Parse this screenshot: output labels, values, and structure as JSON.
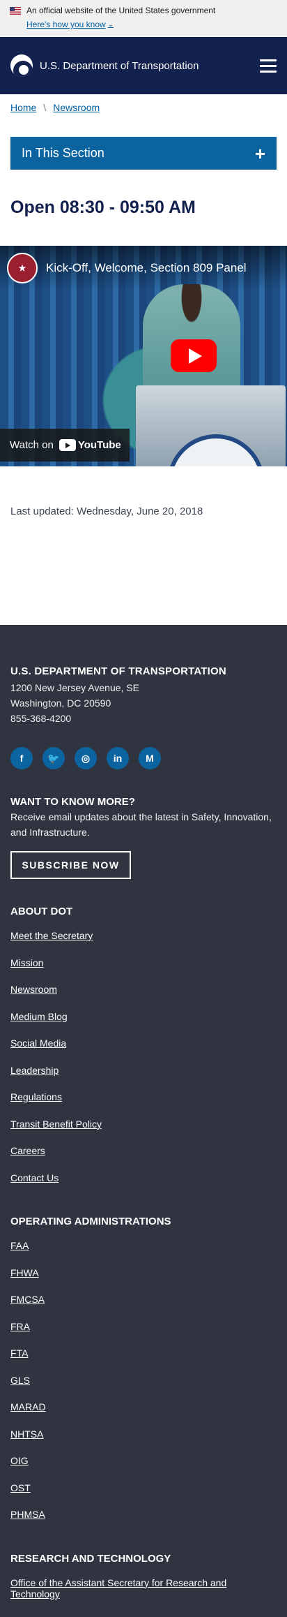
{
  "gov_banner": {
    "text": "An official website of the United States government",
    "link": "Here's how you know"
  },
  "header": {
    "title": "U.S. Department of Transportation"
  },
  "breadcrumb": [
    "Home",
    "Newsroom"
  ],
  "section_bar": {
    "label": "In This Section",
    "toggle": "+"
  },
  "page": {
    "heading": "Open 08:30 - 09:50 AM",
    "last_updated": "Last updated: Wednesday, June 20, 2018"
  },
  "video": {
    "title": "Kick-Off, Welcome, Section 809 Panel",
    "watch_on": "Watch on",
    "platform": "YouTube"
  },
  "footer": {
    "org": "U.S. DEPARTMENT OF TRANSPORTATION",
    "address_line1": "1200 New Jersey Avenue, SE",
    "address_line2": "Washington, DC 20590",
    "phone": "855-368-4200",
    "socials": [
      {
        "icon": "facebook-icon",
        "glyph": "f"
      },
      {
        "icon": "twitter-icon",
        "glyph": "🐦"
      },
      {
        "icon": "instagram-icon",
        "glyph": "◎"
      },
      {
        "icon": "linkedin-icon",
        "glyph": "in"
      },
      {
        "icon": "medium-icon",
        "glyph": "M"
      }
    ],
    "want_heading": "WANT TO KNOW MORE?",
    "want_text": "Receive email updates about the latest in Safety, Innovation, and Infrastructure.",
    "subscribe": "SUBSCRIBE NOW",
    "about_heading": "ABOUT DOT",
    "about_links": [
      "Meet the Secretary",
      "Mission",
      "Newsroom",
      "Medium Blog",
      "Social Media",
      "Leadership",
      "Regulations",
      "Transit Benefit Policy",
      "Careers",
      "Contact Us"
    ],
    "ops_heading": "OPERATING ADMINISTRATIONS",
    "ops_links": [
      "FAA",
      "FHWA",
      "FMCSA",
      "FRA",
      "FTA",
      "GLS",
      "MARAD",
      "NHTSA",
      "OIG",
      "OST",
      "PHMSA"
    ],
    "research_heading": "RESEARCH AND TECHNOLOGY",
    "research_link": "Office of the Assistant Secretary for Research and Technology"
  },
  "colors": {
    "header_bg": "#12214d",
    "accent": "#0b64a0",
    "footer_bg": "#303340",
    "youtube_red": "#ff0000"
  }
}
